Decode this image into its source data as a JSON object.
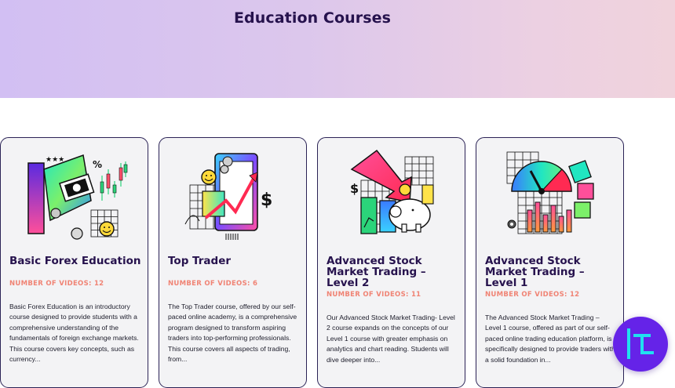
{
  "page": {
    "title": "Education Courses"
  },
  "courses": [
    {
      "title": "Basic Forex Education",
      "meta": "NUMBER OF VIDEOS: 12",
      "description": "Basic Forex Education is an introductory course designed to provide students with a comprehensive understanding of the fundamentals of foreign exchange markets. This course covers key concepts, such as currency...",
      "icon": "forex-chart-illustration-icon"
    },
    {
      "title": "Top Trader",
      "meta": "NUMBER OF VIDEOS: 6",
      "description": "The Top Trader course, offered by our self-paced online academy, is a comprehensive program designed to transform aspiring traders into top-performing professionals. This course covers all aspects of trading, from...",
      "icon": "phone-growth-illustration-icon"
    },
    {
      "title": "Advanced Stock Market Trading – Level 2",
      "meta": "NUMBER OF VIDEOS: 11",
      "description": "Our Advanced Stock Market Trading- Level 2 course expands on the concepts of our Level 1 course with greater emphasis on analytics and chart reading.  Students will dive deeper into...",
      "icon": "piggy-bank-illustration-icon"
    },
    {
      "title": "Advanced Stock Market Trading – Level 1",
      "meta": "NUMBER OF VIDEOS: 12",
      "description": "The Advanced Stock Market Trading – Level 1 course, offered as part of our self-paced online trading education platform, is specifically designed to provide traders with a solid foundation in...",
      "icon": "gauge-bars-illustration-icon"
    }
  ],
  "colors": {
    "title": "#26124d",
    "accent": "#f08374",
    "card_border": "#2b2356",
    "card_bg": "#f3f3f5",
    "logo_bg": "#6523e8",
    "logo_mark": "#20e0f0"
  }
}
